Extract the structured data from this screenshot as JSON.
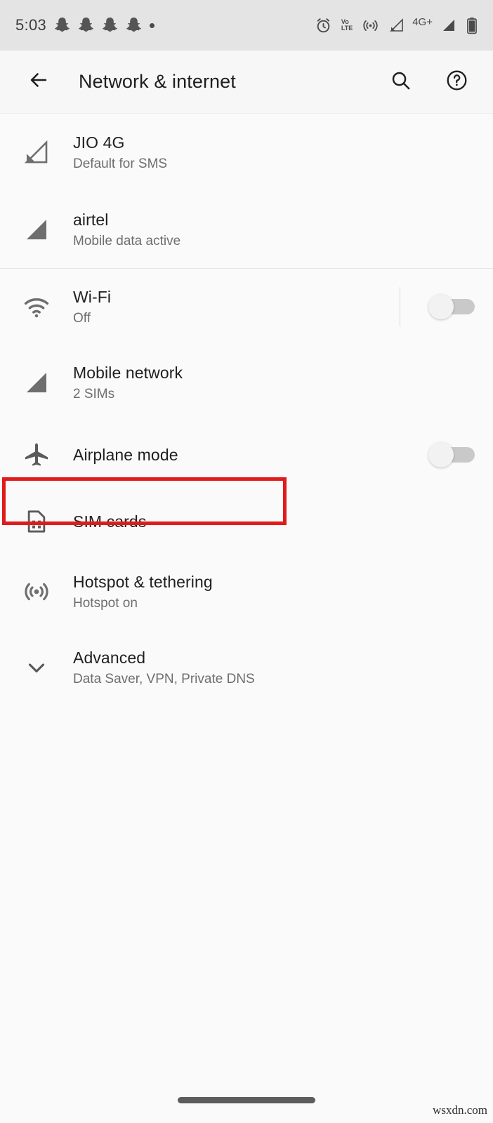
{
  "status_bar": {
    "time": "5:03",
    "notification_icons": [
      "snapchat-icon",
      "snapchat-icon",
      "snapchat-icon",
      "snapchat-icon",
      "more-notifications-dot"
    ],
    "system_icons": [
      "alarm-icon",
      "volte-icon",
      "hotspot-icon",
      "signal-sim1-icon",
      "4g-plus-label",
      "signal-sim2-icon",
      "battery-icon"
    ],
    "volte_top": "Vo",
    "volte_bottom": "LTE",
    "network_type": "4G+"
  },
  "app_bar": {
    "back_icon": "back-arrow-icon",
    "title": "Network & internet",
    "search_icon": "search-icon",
    "help_icon": "help-icon"
  },
  "sim_section": [
    {
      "icon": "signal-partial-icon",
      "title": "JIO 4G",
      "subtitle": "Default for SMS"
    },
    {
      "icon": "signal-full-icon",
      "title": "airtel",
      "subtitle": "Mobile data active"
    }
  ],
  "settings_section": [
    {
      "icon": "wifi-icon",
      "title": "Wi-Fi",
      "subtitle": "Off",
      "toggle": "off",
      "has_divider": true
    },
    {
      "icon": "signal-full-icon",
      "title": "Mobile network",
      "subtitle": "2 SIMs",
      "toggle": "none",
      "has_divider": false
    },
    {
      "icon": "airplane-icon",
      "title": "Airplane mode",
      "subtitle": "",
      "toggle": "off",
      "has_divider": false
    },
    {
      "icon": "sim-card-icon",
      "title": "SIM cards",
      "subtitle": "",
      "toggle": "none",
      "has_divider": false,
      "highlighted": true
    },
    {
      "icon": "hotspot-icon",
      "title": "Hotspot & tethering",
      "subtitle": "Hotspot on",
      "toggle": "none",
      "has_divider": false
    },
    {
      "icon": "chevron-down-icon",
      "title": "Advanced",
      "subtitle": "Data Saver, VPN, Private DNS",
      "toggle": "none",
      "has_divider": false
    }
  ],
  "highlight": {
    "color": "#e01b1b",
    "target": "SIM cards"
  },
  "footer": {
    "watermark": "wsxdn.com",
    "nav_pill": "home-gesture-pill"
  },
  "colors": {
    "background": "#fafafa",
    "status_bar": "#e4e4e4",
    "app_bar": "#f7f7f7",
    "primary_text": "#1f1f1f",
    "secondary_text": "#6e6e6e",
    "highlight": "#e01b1b"
  }
}
